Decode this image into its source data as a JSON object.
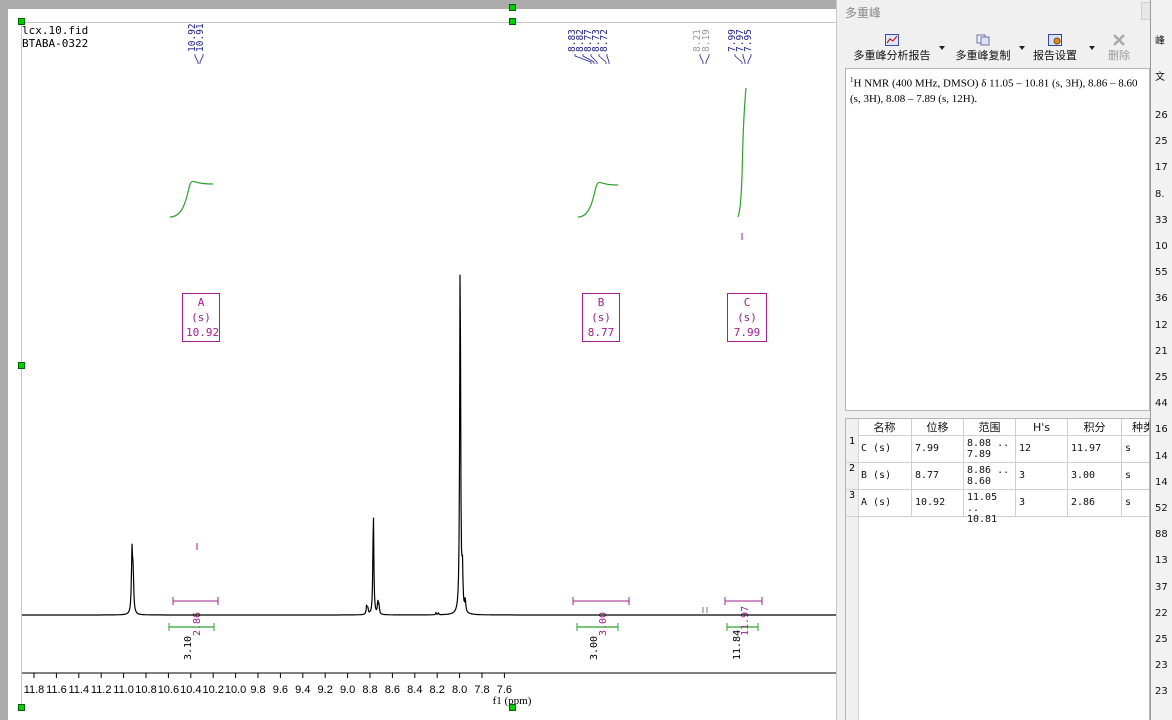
{
  "spectrum": {
    "file_name": "lcx.10.fid",
    "sample_name": "BTABA-0322",
    "x_axis_label": "f1 (ppm)",
    "x_ticks": [
      "11.8",
      "11.6",
      "11.4",
      "11.2",
      "11.0",
      "10.8",
      "10.6",
      "10.4",
      "10.2",
      "10.0",
      "9.8",
      "9.6",
      "9.4",
      "9.2",
      "9.0",
      "8.8",
      "8.6",
      "8.4",
      "8.2",
      "8.0",
      "7.8",
      "7.6"
    ],
    "peak_labels": [
      {
        "group": "A",
        "ppm": [
          "10.92",
          "10.91"
        ]
      },
      {
        "group": "B",
        "ppm": [
          "8.83",
          "8.82",
          "8.77",
          "8.73",
          "8.72"
        ]
      },
      {
        "group": "C",
        "ppm": [
          "8.21",
          "8.19",
          "7.99",
          "7.97",
          "7.95"
        ]
      }
    ],
    "multiplets": [
      {
        "label": "A (s)",
        "shift": "10.92"
      },
      {
        "label": "B (s)",
        "shift": "8.77"
      },
      {
        "label": "C (s)",
        "shift": "7.99"
      }
    ],
    "integrals": [
      "3.10",
      "3.00",
      "11.84"
    ],
    "multiplet_integrals": [
      "2.86",
      "3.00",
      "11.97"
    ]
  },
  "panel": {
    "title": "多重峰",
    "toolbar": {
      "report": "多重峰分析报告",
      "copy": "多重峰复制",
      "settings": "报告设置",
      "delete": "删除"
    },
    "report_sup": "1",
    "report_text": "H NMR (400 MHz, DMSO) δ 11.05 – 10.81 (s, 3H), 8.86 – 8.60 (s, 3H), 8.08 – 7.89 (s, 12H).",
    "table": {
      "headers": [
        "名称",
        "位移",
        "范围",
        "H's",
        "积分",
        "种类"
      ],
      "rows": [
        {
          "no": "1",
          "name": "C (s)",
          "shift": "7.99",
          "range_from": "8.08 ..",
          "range_to": "7.89",
          "h": "12",
          "integral": "11.97",
          "type": "s"
        },
        {
          "no": "2",
          "name": "B (s)",
          "shift": "8.77",
          "range_from": "8.86 ..",
          "range_to": "8.60",
          "h": "3",
          "integral": "3.00",
          "type": "s"
        },
        {
          "no": "3",
          "name": "A (s)",
          "shift": "10.92",
          "range_from": "11.05 ..",
          "range_to": "10.81",
          "h": "3",
          "integral": "2.86",
          "type": "s"
        }
      ]
    }
  },
  "side_strip": {
    "header": "峰",
    "sub": "文",
    "values": [
      "26",
      "25",
      "17",
      "8.",
      "33",
      "10",
      "55",
      "36",
      "12",
      "21",
      "25",
      "44",
      "16",
      "14",
      "14",
      "52",
      "88",
      "13",
      "37",
      "22",
      "25",
      "23",
      "23"
    ]
  },
  "colors": {
    "spectrum_line": "#000000",
    "integral_curve": "#2ca02c",
    "multiplet_box": "#a0208c",
    "peak_label": "#1f1f8c",
    "handle": "#00d000"
  }
}
